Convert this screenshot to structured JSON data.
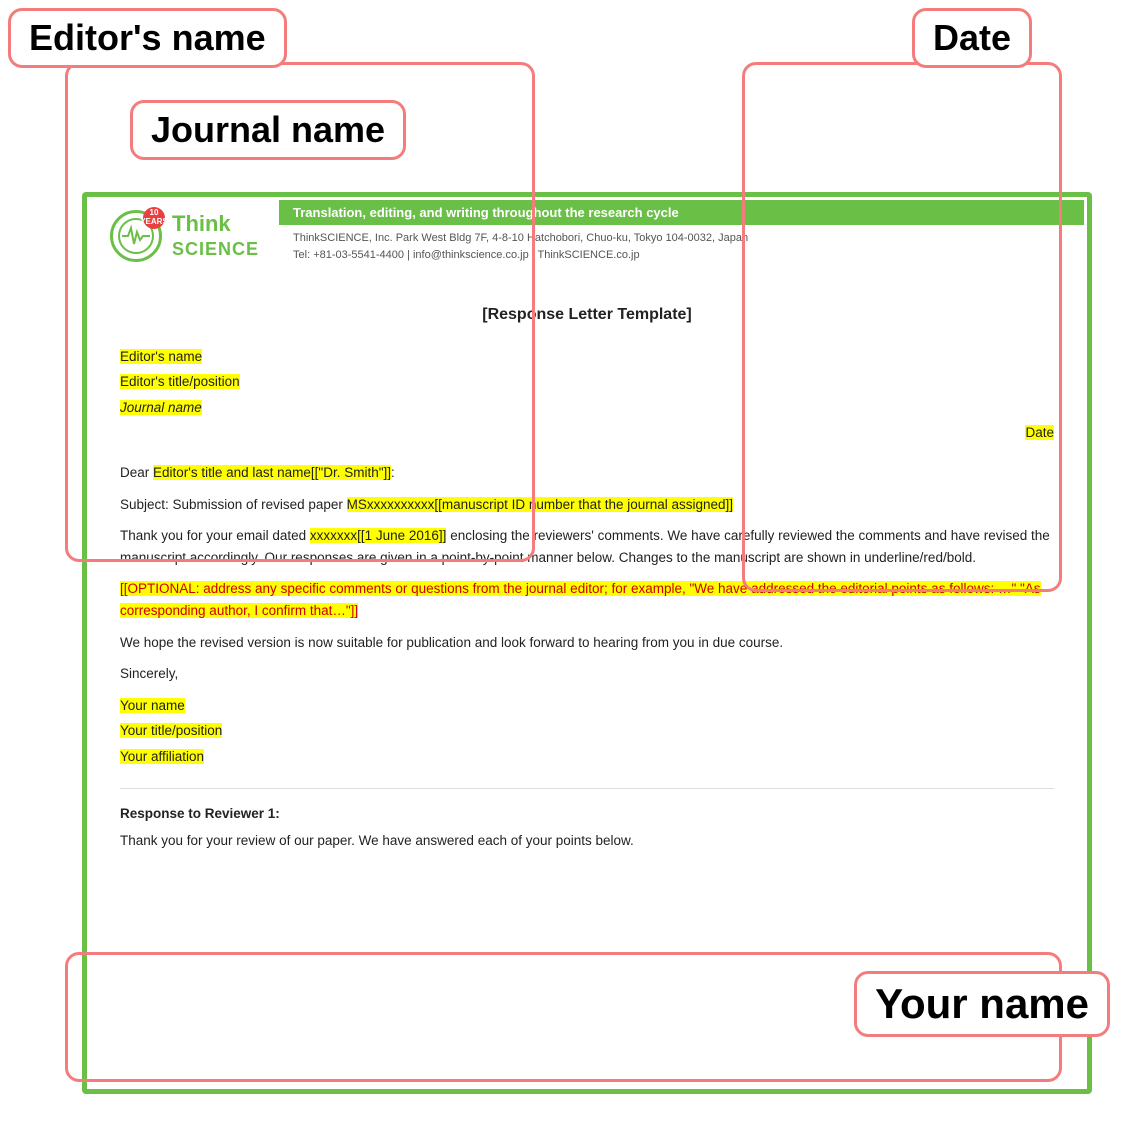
{
  "annotations": {
    "editors_name_label": "Editor's name",
    "journal_name_label": "Journal name",
    "your_name_label": "Your name",
    "date_label": "Date"
  },
  "letter": {
    "title": "[Response Letter Template]",
    "editor_name": "Editor's name",
    "editor_title": "Editor's title/position",
    "journal_name": "Journal name",
    "date": "Date",
    "salutation": "Dear ",
    "editor_placeholder": "Editor's title and last name[[\"Dr. Smith\"]]",
    "salutation_end": ":",
    "subject_prefix": "Subject:  Submission of revised paper  ",
    "subject_highlight": "MSxxxxxxxxxx[[manuscript ID number that the journal assigned]]",
    "body1_pre": "Thank you for your email dated ",
    "body1_date_highlight": "xxxxxxx[[1 June 2016]]",
    "body1_post": " enclosing the reviewers' comments. We have carefully reviewed the comments and have revised the manuscript accordingly. Our responses are given in a point-by-point manner below. Changes to the manuscript are shown in underline/red/bold.",
    "optional_highlight": "[[OPTIONAL: address any specific comments or questions from the journal editor; for example, \"We have addressed the editorial points as follows: …\" \"As corresponding author, I confirm that…\"]]",
    "body2": "We hope the revised version is now suitable for publication and look forward to hearing from you in due course.",
    "sincerely": "Sincerely,",
    "your_name": "Your name",
    "your_title": "Your title/position",
    "your_affiliation": "Your affiliation",
    "reviewer_section_title": "Response to Reviewer 1:",
    "reviewer_body": "Thank you for your review of our paper. We have answered each of your points below."
  },
  "logo": {
    "years": "10\nYEARS",
    "name_line1": "Think",
    "name_line2": "SCIENCE",
    "tagline": "Translation, editing, and writing throughout the research cycle",
    "address": "ThinkSCIENCE, Inc.  Park West Bldg 7F, 4-8-10 Hatchobori, Chuo-ku, Tokyo 104-0032, Japan",
    "contact": "Tel: +81-03-5541-4400 | info@thinkscience.co.jp | ThinkSCIENCE.co.jp"
  }
}
